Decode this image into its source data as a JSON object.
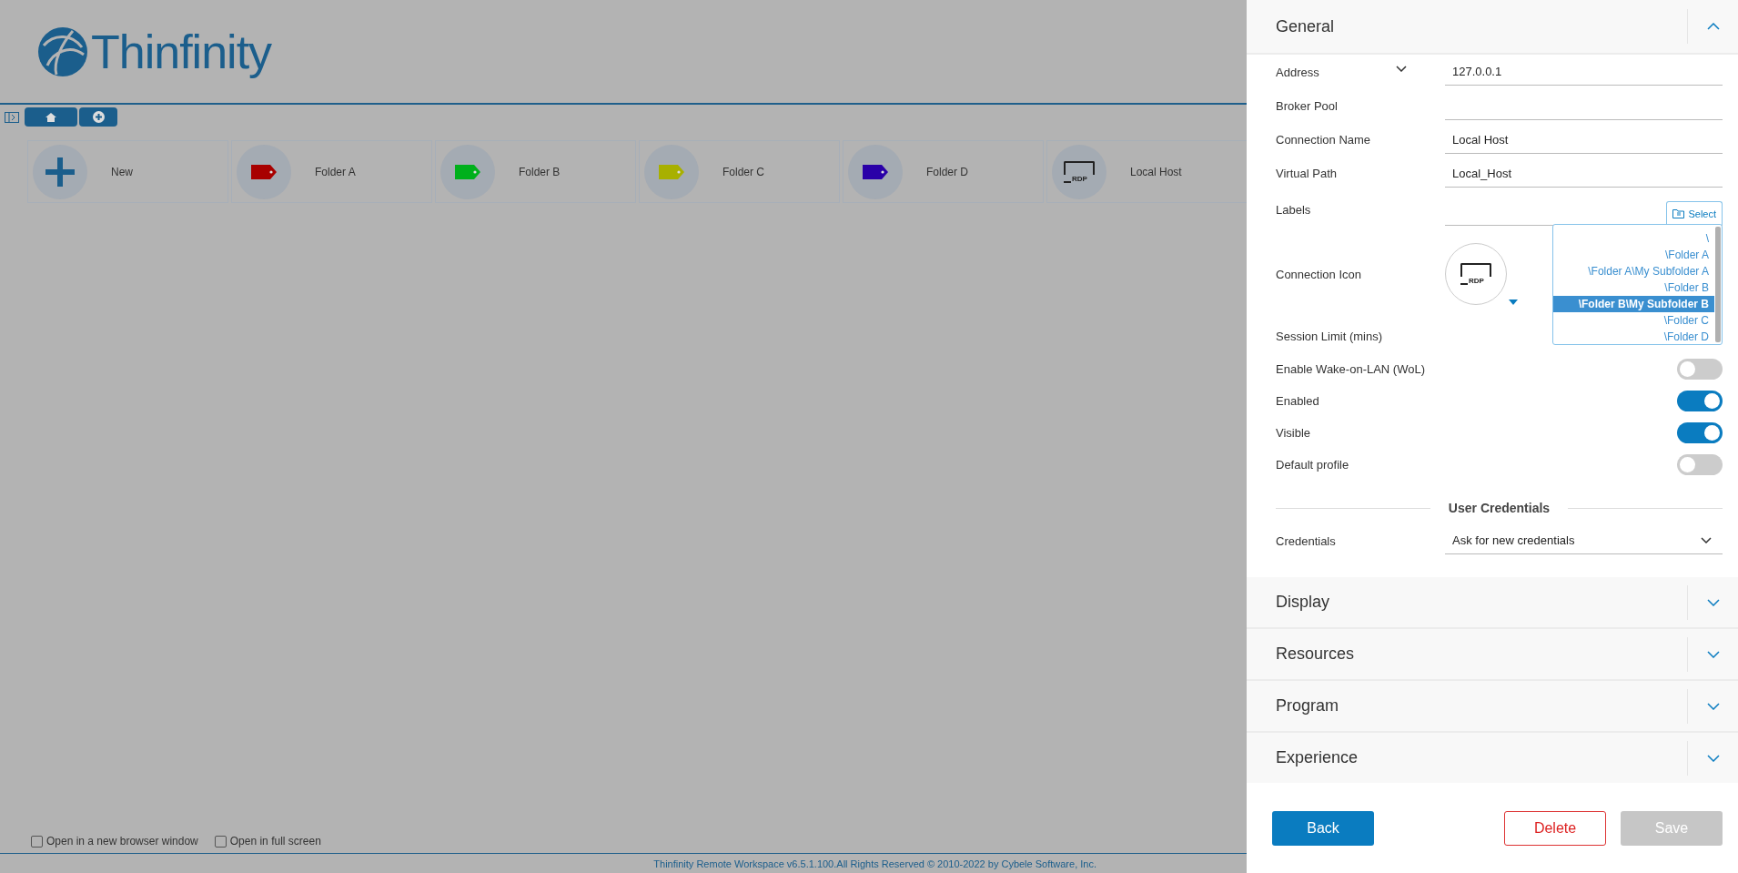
{
  "logo": {
    "text": "Thinfinity"
  },
  "tiles": [
    {
      "kind": "new",
      "label": "New"
    },
    {
      "kind": "folder",
      "label": "Folder A",
      "color": "#a80000"
    },
    {
      "kind": "folder",
      "label": "Folder B",
      "color": "#00b01c"
    },
    {
      "kind": "folder",
      "label": "Folder C",
      "color": "#a8b000"
    },
    {
      "kind": "folder",
      "label": "Folder D",
      "color": "#2a00a8"
    },
    {
      "kind": "rdp",
      "label": "Local Host",
      "badge": "RDP"
    }
  ],
  "options": [
    {
      "label": "Open in a new browser window",
      "checked": false
    },
    {
      "label": "Open in full screen",
      "checked": false
    }
  ],
  "footer": "Thinfinity Remote Workspace v6.5.1.100.All Rights Reserved © 2010-2022 by Cybele Software, Inc.",
  "sections": [
    {
      "title": "General",
      "expanded": true
    },
    {
      "title": "Display",
      "expanded": false
    },
    {
      "title": "Resources",
      "expanded": false
    },
    {
      "title": "Program",
      "expanded": false
    },
    {
      "title": "Experience",
      "expanded": false
    }
  ],
  "general": [
    {
      "kind": "address",
      "label": "Address",
      "value": "127.0.0.1"
    },
    {
      "kind": "text",
      "label": "Broker Pool"
    },
    {
      "kind": "text",
      "label": "Connection Name",
      "value": "Local Host"
    },
    {
      "kind": "text",
      "label": "Virtual Path",
      "value": "Local_Host"
    },
    {
      "kind": "labels",
      "label": "Labels",
      "button": "Select"
    },
    {
      "kind": "icon",
      "label": "Connection Icon",
      "badge": "RDP"
    },
    {
      "kind": "plain",
      "label": "Session Limit (mins)"
    },
    {
      "kind": "toggle",
      "label": "Enable Wake-on-LAN (WoL)",
      "on": false
    },
    {
      "kind": "toggle",
      "label": "Enabled",
      "on": true
    },
    {
      "kind": "toggle",
      "label": "Visible",
      "on": true
    },
    {
      "kind": "toggle",
      "label": "Default profile",
      "on": false
    },
    {
      "kind": "heading",
      "label": "User Credentials"
    },
    {
      "kind": "select",
      "label": "Credentials",
      "value": "Ask for new credentials"
    }
  ],
  "label_dropdown": [
    {
      "label": "\\",
      "selected": false
    },
    {
      "label": "\\Folder A",
      "selected": false
    },
    {
      "label": "\\Folder A\\My Subfolder A",
      "selected": false
    },
    {
      "label": "\\Folder B",
      "selected": false
    },
    {
      "label": "\\Folder B\\My Subfolder B",
      "selected": true
    },
    {
      "label": "\\Folder C",
      "selected": false
    },
    {
      "label": "\\Folder D",
      "selected": false
    }
  ],
  "buttons": [
    {
      "kind": "back",
      "label": "Back",
      "disabled": false
    },
    {
      "kind": "delete",
      "label": "Delete",
      "disabled": false
    },
    {
      "kind": "save",
      "label": "Save",
      "disabled": true
    }
  ]
}
